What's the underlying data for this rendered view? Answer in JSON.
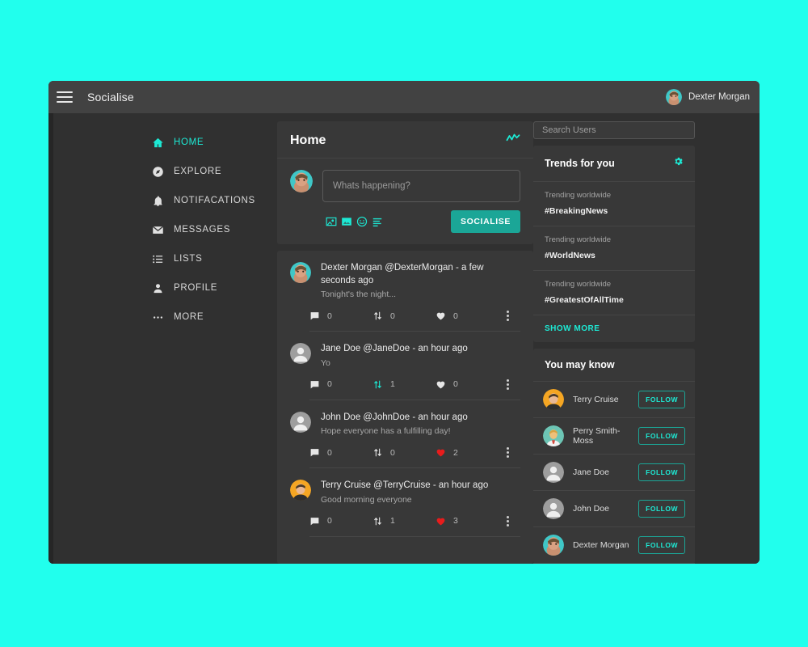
{
  "theme": {
    "page_background": "#21FFED",
    "window_background": "#303030",
    "panel_background": "#383838",
    "appbar_background": "#424242",
    "accent_teal": "#1DE9D4",
    "button_teal": "#1BA697",
    "heart_red": "#E81C1C"
  },
  "header": {
    "menu_icon": "hamburger-icon",
    "title": "Socialise",
    "profile": {
      "name": "Dexter Morgan",
      "avatar": "dexter-avatar"
    }
  },
  "sidebar": {
    "items": [
      {
        "label": "HOME",
        "icon": "home-icon",
        "active": true
      },
      {
        "label": "EXPLORE",
        "icon": "compass-icon",
        "active": false
      },
      {
        "label": "NOTIFACATIONS",
        "icon": "bell-icon",
        "active": false
      },
      {
        "label": "MESSAGES",
        "icon": "envelope-icon",
        "active": false
      },
      {
        "label": "LISTS",
        "icon": "list-icon",
        "active": false
      },
      {
        "label": "PROFILE",
        "icon": "person-icon",
        "active": false
      },
      {
        "label": "MORE",
        "icon": "ellipsis-icon",
        "active": false
      }
    ]
  },
  "feed": {
    "title": "Home",
    "trend_icon": "trend-line-icon",
    "compose": {
      "avatar": "dexter-avatar",
      "placeholder": "Whats happening?",
      "value": "",
      "submit_label": "SOCIALISE",
      "icons": [
        "image-person-icon",
        "image-icon",
        "emoji-icon",
        "poll-icon"
      ]
    },
    "posts": [
      {
        "avatar": "dexter-avatar",
        "name": "Dexter Morgan",
        "handle": "@DexterMorgan",
        "time": "a few seconds ago",
        "header": "Dexter Morgan @DexterMorgan - a few seconds ago",
        "text": "Tonight's the night...",
        "comments": "0",
        "retweets": "0",
        "likes": "0",
        "retweeted": false,
        "liked": false
      },
      {
        "avatar": "blank-avatar",
        "name": "Jane Doe",
        "handle": "@JaneDoe",
        "time": "an hour ago",
        "header": "Jane Doe @JaneDoe - an hour ago",
        "text": "Yo",
        "comments": "0",
        "retweets": "1",
        "likes": "0",
        "retweeted": true,
        "liked": false
      },
      {
        "avatar": "blank-avatar",
        "name": "John Doe",
        "handle": "@JohnDoe",
        "time": "an hour ago",
        "header": "John Doe @JohnDoe - an hour ago",
        "text": "Hope everyone has a fulfilling day!",
        "comments": "0",
        "retweets": "0",
        "likes": "2",
        "retweeted": false,
        "liked": true
      },
      {
        "avatar": "terry-avatar",
        "name": "Terry Cruise",
        "handle": "@TerryCruise",
        "time": "an hour ago",
        "header": "Terry Cruise @TerryCruise - an hour ago",
        "text": "Good morning everyone",
        "comments": "0",
        "retweets": "1",
        "likes": "3",
        "retweeted": false,
        "liked": true
      }
    ]
  },
  "right_rail": {
    "search": {
      "placeholder": "Search Users",
      "value": ""
    },
    "trends": {
      "title": "Trends for you",
      "settings_icon": "gear-icon",
      "items": [
        {
          "subtitle": "Trending worldwide",
          "tag": "#BreakingNews"
        },
        {
          "subtitle": "Trending worldwide",
          "tag": "#WorldNews"
        },
        {
          "subtitle": "Trending worldwide",
          "tag": "#GreatestOfAllTime"
        }
      ],
      "show_more_label": "SHOW MORE"
    },
    "you_may_know": {
      "title": "You may know",
      "follow_label": "FOLLOW",
      "people": [
        {
          "name": "Terry Cruise",
          "avatar": "terry-avatar"
        },
        {
          "name": "Perry Smith-Moss",
          "avatar": "perry-avatar"
        },
        {
          "name": "Jane Doe",
          "avatar": "blank-avatar"
        },
        {
          "name": "John Doe",
          "avatar": "blank-avatar"
        },
        {
          "name": "Dexter Morgan",
          "avatar": "dexter-avatar"
        }
      ]
    }
  }
}
